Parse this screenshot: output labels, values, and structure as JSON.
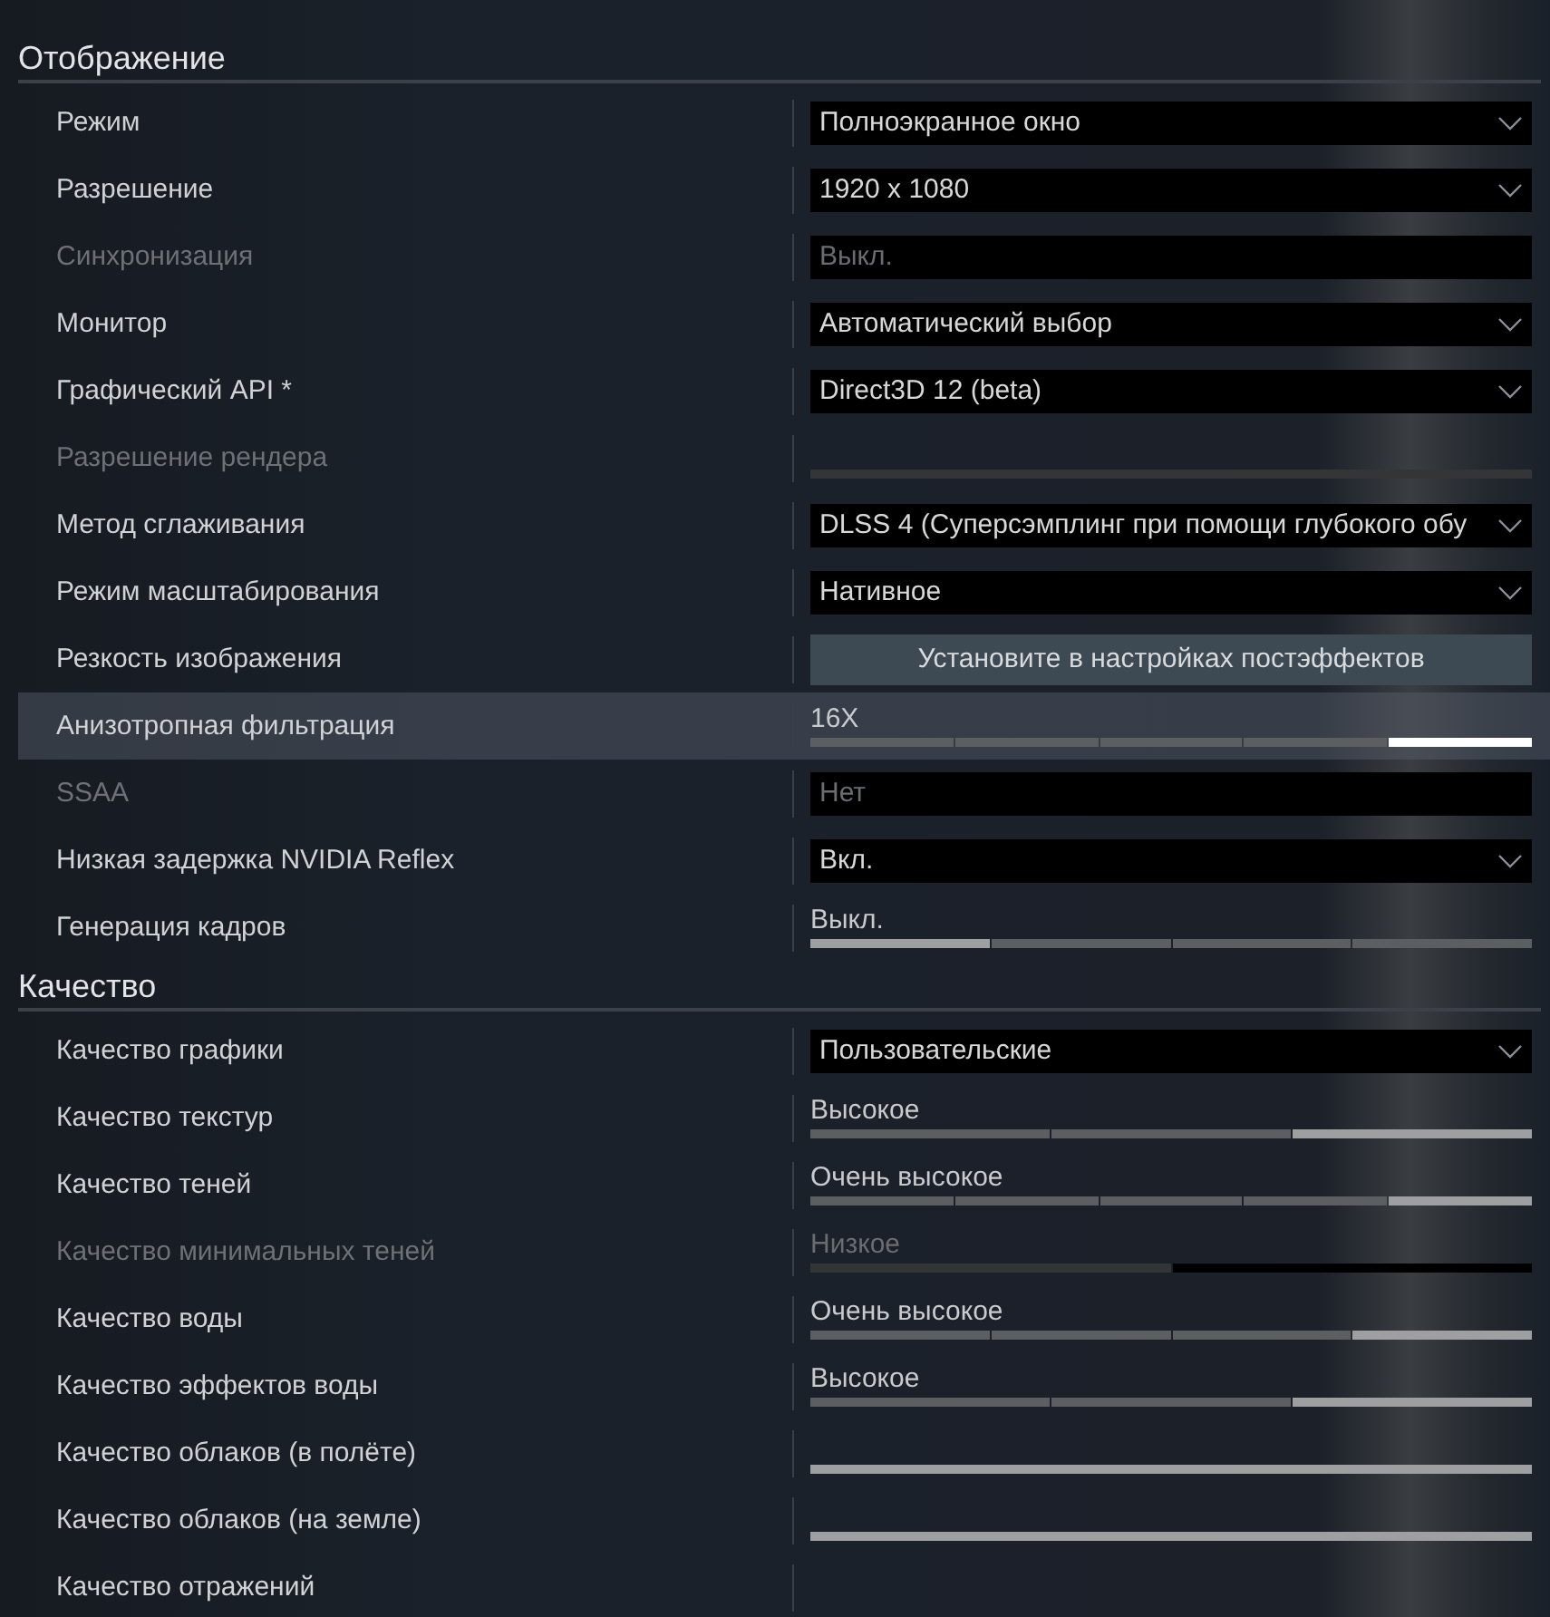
{
  "sections": [
    {
      "title": "Отображение",
      "rows": [
        {
          "label": "Режим",
          "kind": "dropdown",
          "disabled": false,
          "highlighted": false,
          "value": "Полноэкранное окно"
        },
        {
          "label": "Разрешение",
          "kind": "dropdown",
          "disabled": false,
          "highlighted": false,
          "value": "1920 x 1080"
        },
        {
          "label": "Синхронизация",
          "kind": "field",
          "disabled": true,
          "highlighted": false,
          "value": "Выкл."
        },
        {
          "label": "Монитор",
          "kind": "dropdown",
          "disabled": false,
          "highlighted": false,
          "value": "Автоматический выбор"
        },
        {
          "label": "Графический API *",
          "kind": "dropdown",
          "disabled": false,
          "highlighted": false,
          "value": "Direct3D 12 (beta)"
        },
        {
          "label": "Разрешение рендера",
          "kind": "slider",
          "disabled": true,
          "highlighted": false,
          "segments": [
            {
              "selected": true
            }
          ]
        },
        {
          "label": "Метод сглаживания",
          "kind": "dropdown",
          "disabled": false,
          "highlighted": false,
          "value": "DLSS 4 (Суперсэмплинг при помощи глубокого обу"
        },
        {
          "label": "Режим масштабирования",
          "kind": "dropdown",
          "disabled": false,
          "highlighted": false,
          "value": "Нативное"
        },
        {
          "label": "Резкость изображения",
          "kind": "button",
          "disabled": false,
          "highlighted": false,
          "value": "Установите в настройках постэффектов"
        },
        {
          "label": "Анизотропная фильтрация",
          "kind": "slider",
          "disabled": false,
          "highlighted": true,
          "value": "16X",
          "segments": [
            {
              "selected": false
            },
            {
              "selected": false
            },
            {
              "selected": false
            },
            {
              "selected": false
            },
            {
              "selected": true
            }
          ]
        },
        {
          "label": "SSAA",
          "kind": "field",
          "disabled": true,
          "highlighted": false,
          "value": "Нет"
        },
        {
          "label": "Низкая задержка NVIDIA Reflex",
          "kind": "dropdown",
          "disabled": false,
          "highlighted": false,
          "value": "Вкл."
        },
        {
          "label": "Генерация кадров",
          "kind": "slider",
          "disabled": false,
          "highlighted": false,
          "value": "Выкл.",
          "segments": [
            {
              "selected": true
            },
            {
              "selected": false
            },
            {
              "selected": false
            },
            {
              "selected": false
            }
          ]
        }
      ]
    },
    {
      "title": "Качество",
      "rows": [
        {
          "label": "Качество графики",
          "kind": "dropdown",
          "disabled": false,
          "highlighted": false,
          "value": "Пользовательские"
        },
        {
          "label": "Качество текстур",
          "kind": "slider",
          "disabled": false,
          "highlighted": false,
          "value": "Высокое",
          "segments": [
            {
              "selected": false
            },
            {
              "selected": false
            },
            {
              "selected": true
            }
          ]
        },
        {
          "label": "Качество теней",
          "kind": "slider",
          "disabled": false,
          "highlighted": false,
          "value": "Очень высокое",
          "segments": [
            {
              "selected": false
            },
            {
              "selected": false
            },
            {
              "selected": false
            },
            {
              "selected": false
            },
            {
              "selected": true
            }
          ]
        },
        {
          "label": "Качество минимальных теней",
          "kind": "slider",
          "disabled": true,
          "highlighted": false,
          "value": "Низкое",
          "segments": [
            {
              "selected": true
            },
            {
              "selected": false
            }
          ]
        },
        {
          "label": "Качество воды",
          "kind": "slider",
          "disabled": false,
          "highlighted": false,
          "value": "Очень высокое",
          "segments": [
            {
              "selected": false
            },
            {
              "selected": false
            },
            {
              "selected": false
            },
            {
              "selected": true
            }
          ]
        },
        {
          "label": "Качество эффектов воды",
          "kind": "slider",
          "disabled": false,
          "highlighted": false,
          "value": "Высокое",
          "segments": [
            {
              "selected": false
            },
            {
              "selected": false
            },
            {
              "selected": true
            }
          ]
        },
        {
          "label": "Качество облаков (в полёте)",
          "kind": "slider",
          "disabled": false,
          "highlighted": false,
          "segments": [
            {
              "selected": true
            }
          ]
        },
        {
          "label": "Качество облаков (на земле)",
          "kind": "slider",
          "disabled": false,
          "highlighted": false,
          "segments": [
            {
              "selected": true
            }
          ]
        },
        {
          "label": "Качество отражений",
          "kind": "empty",
          "disabled": false,
          "highlighted": false
        }
      ]
    }
  ]
}
